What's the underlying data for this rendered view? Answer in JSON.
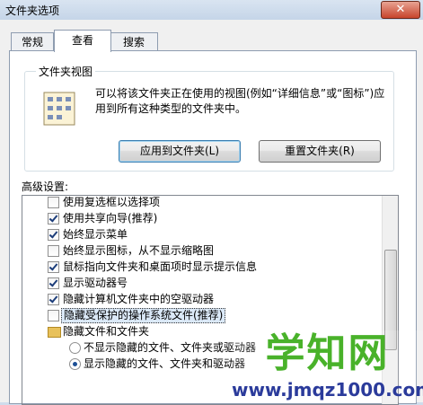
{
  "window": {
    "title": "文件夹选项"
  },
  "tabs": [
    {
      "label": "常规",
      "active": false
    },
    {
      "label": "查看",
      "active": true
    },
    {
      "label": "搜索",
      "active": false
    }
  ],
  "folder_view": {
    "group_label": "文件夹视图",
    "description": "可以将该文件夹正在使用的视图(例如“详细信息”或“图标”)应用到所有这种类型的文件夹中。",
    "apply_button": "应用到文件夹(L)",
    "reset_button": "重置文件夹(R)"
  },
  "advanced": {
    "label": "高级设置:",
    "items": [
      {
        "type": "checkbox",
        "label": "使用复选框以选择项",
        "checked": false
      },
      {
        "type": "checkbox",
        "label": "使用共享向导(推荐)",
        "checked": true
      },
      {
        "type": "checkbox",
        "label": "始终显示菜单",
        "checked": true
      },
      {
        "type": "checkbox",
        "label": "始终显示图标，从不显示缩略图",
        "checked": false
      },
      {
        "type": "checkbox",
        "label": "鼠标指向文件夹和桌面项时显示提示信息",
        "checked": true
      },
      {
        "type": "checkbox",
        "label": "显示驱动器号",
        "checked": true
      },
      {
        "type": "checkbox",
        "label": "隐藏计算机文件夹中的空驱动器",
        "checked": true
      },
      {
        "type": "checkbox",
        "label": "隐藏受保护的操作系统文件(推荐)",
        "checked": false,
        "selected": true
      },
      {
        "type": "folder",
        "label": "隐藏文件和文件夹"
      },
      {
        "type": "radio",
        "label": "不显示隐藏的文件、文件夹或驱动器",
        "checked": false
      },
      {
        "type": "radio",
        "label": "显示隐藏的文件、文件夹和驱动器",
        "checked": true
      }
    ]
  },
  "watermark": {
    "title": "学知网",
    "url": "www.jmqz1000.com"
  },
  "colors": {
    "accent": "#3c7fb1",
    "watermark_green": "#49b22a",
    "watermark_blue": "#2b3b9b"
  }
}
